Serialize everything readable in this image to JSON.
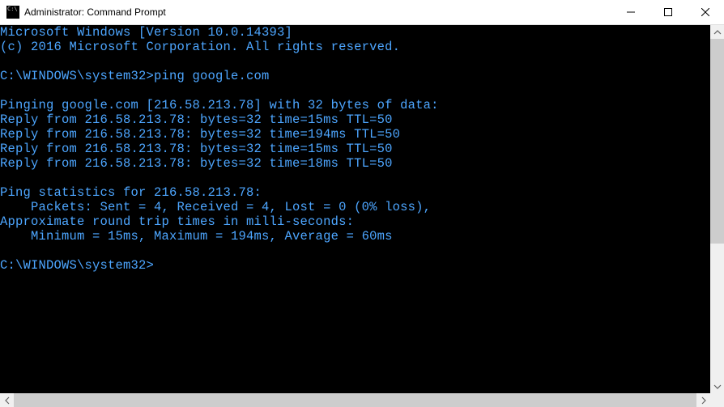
{
  "window": {
    "title": "Administrator: Command Prompt"
  },
  "terminal": {
    "lines": [
      "Microsoft Windows [Version 10.0.14393]",
      "(c) 2016 Microsoft Corporation. All rights reserved.",
      "",
      "C:\\WINDOWS\\system32>ping google.com",
      "",
      "Pinging google.com [216.58.213.78] with 32 bytes of data:",
      "Reply from 216.58.213.78: bytes=32 time=15ms TTL=50",
      "Reply from 216.58.213.78: bytes=32 time=194ms TTL=50",
      "Reply from 216.58.213.78: bytes=32 time=15ms TTL=50",
      "Reply from 216.58.213.78: bytes=32 time=18ms TTL=50",
      "",
      "Ping statistics for 216.58.213.78:",
      "    Packets: Sent = 4, Received = 4, Lost = 0 (0% loss),",
      "Approximate round trip times in milli-seconds:",
      "    Minimum = 15ms, Maximum = 194ms, Average = 60ms",
      "",
      "C:\\WINDOWS\\system32>"
    ]
  }
}
